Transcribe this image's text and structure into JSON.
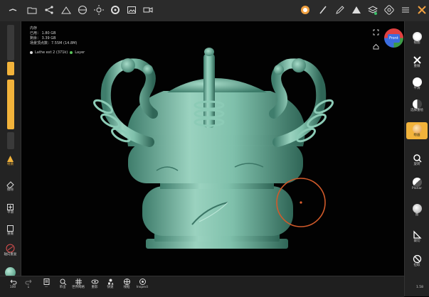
{
  "topbar": {
    "icons": [
      "sparkle-icon",
      "folder-icon",
      "share-icon",
      "scene-icon",
      "globe-icon",
      "sun-icon",
      "settings-icon",
      "image-icon",
      "video-icon"
    ],
    "right_icons": [
      "brush-icon",
      "pen-icon",
      "triangle-icon",
      "layers-icon",
      "gear-icon",
      "sliders-icon",
      "tools-icon"
    ]
  },
  "stats": {
    "line1": "内存",
    "line2": "已用： 1.80 GB",
    "line3": "剩余： 3.39 GB",
    "line4": "场景顶点数：7.55M (14.8M)"
  },
  "layer": {
    "object": "Lathe ext 2 (371k)",
    "layer": "Layer"
  },
  "left_tools": [
    {
      "label": "材质"
    },
    {
      "label": "擦除"
    },
    {
      "label": "平滑"
    },
    {
      "label": "重做"
    },
    {
      "label": "轴向重复"
    }
  ],
  "right_tools": [
    {
      "label": "视图"
    },
    {
      "label": "重做"
    },
    {
      "label": "平滑"
    },
    {
      "label": "选择重绘"
    },
    {
      "label": "绘画"
    },
    {
      "label": "旋转"
    },
    {
      "label": "Planar"
    },
    {
      "label": "图"
    },
    {
      "label": "裁切"
    },
    {
      "label": "拉取"
    }
  ],
  "bottom_tools": [
    {
      "label": "100"
    },
    {
      "label": "↓"
    },
    {
      "label": "—"
    },
    {
      "label": "单击"
    },
    {
      "label": "世界网格"
    },
    {
      "label": "重影"
    },
    {
      "label": "快速"
    },
    {
      "label": "线框"
    },
    {
      "label": "Inspect"
    }
  ],
  "view_cube": {
    "label": "Front"
  },
  "corner_version": "1.58"
}
